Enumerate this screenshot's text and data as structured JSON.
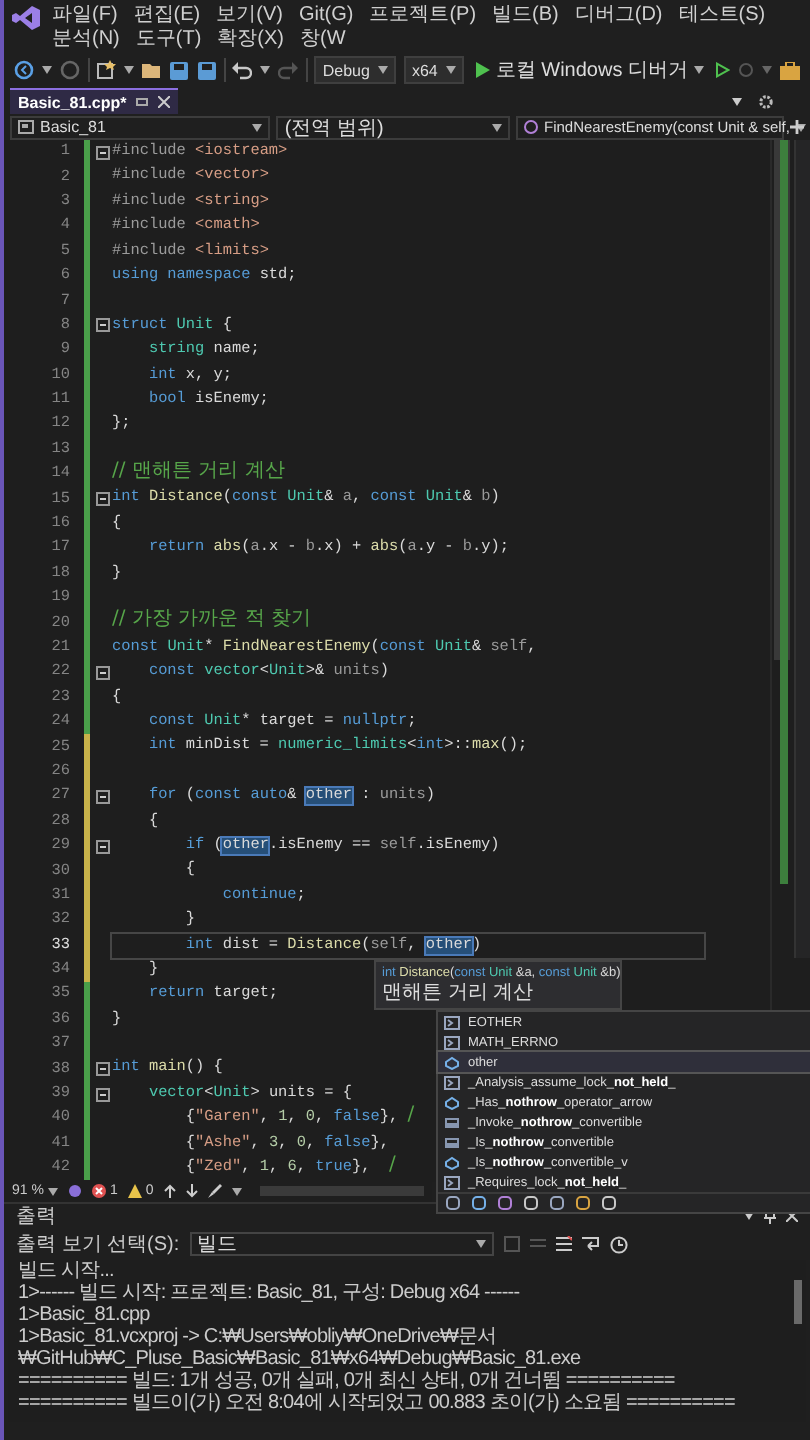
{
  "menu": [
    "파일(F)",
    "편집(E)",
    "보기(V)",
    "Git(G)",
    "프로젝트(P)",
    "빌드(B)",
    "디버그(D)",
    "테스트(S)",
    "분석(N)",
    "도구(T)",
    "확장(X)",
    "창(W"
  ],
  "toolbar": {
    "configuration": "Debug",
    "platform": "x64",
    "run_label": "로컬 Windows 디버거"
  },
  "tabs": [
    {
      "label": "Basic_81.cpp*",
      "selected": true
    }
  ],
  "navigation": {
    "project": "Basic_81",
    "scope": "(전역 범위)",
    "member": "FindNearestEnemy(const Unit & self,"
  },
  "editor": {
    "lines": [
      {
        "n": "1",
        "modified": false,
        "fold": true,
        "current": false,
        "tokens": [
          {
            "kind": "pp",
            "text": "#include "
          },
          {
            "kind": "str",
            "text": "<iostream>"
          }
        ]
      },
      {
        "n": "2",
        "modified": false,
        "fold": false,
        "current": false,
        "tokens": [
          {
            "kind": "pp",
            "text": "#include "
          },
          {
            "kind": "str",
            "text": "<vector>"
          }
        ]
      },
      {
        "n": "3",
        "modified": false,
        "fold": false,
        "current": false,
        "tokens": [
          {
            "kind": "pp",
            "text": "#include "
          },
          {
            "kind": "str",
            "text": "<string>"
          }
        ]
      },
      {
        "n": "4",
        "modified": false,
        "fold": false,
        "current": false,
        "tokens": [
          {
            "kind": "pp",
            "text": "#include "
          },
          {
            "kind": "str",
            "text": "<cmath>"
          }
        ]
      },
      {
        "n": "5",
        "modified": false,
        "fold": false,
        "current": false,
        "tokens": [
          {
            "kind": "pp",
            "text": "#include "
          },
          {
            "kind": "str",
            "text": "<limits>"
          }
        ]
      },
      {
        "n": "6",
        "modified": false,
        "fold": false,
        "current": false,
        "tokens": [
          {
            "kind": "kw",
            "text": "using namespace"
          },
          {
            "kind": "tx",
            "text": " std;"
          }
        ]
      },
      {
        "n": "7",
        "modified": false,
        "fold": false,
        "current": false
      },
      {
        "n": "8",
        "modified": false,
        "fold": true,
        "current": false,
        "tokens": [
          {
            "kind": "kw",
            "text": "struct "
          },
          {
            "kind": "type",
            "text": "Unit"
          },
          {
            "kind": "tx",
            "text": " {"
          }
        ]
      },
      {
        "n": "9",
        "modified": false,
        "fold": false,
        "current": false,
        "tokens": [
          {
            "kind": "type",
            "text": "    string"
          },
          {
            "kind": "tx",
            "text": " name;"
          }
        ]
      },
      {
        "n": "10",
        "modified": false,
        "fold": false,
        "current": false,
        "tokens": [
          {
            "kind": "kw",
            "text": "    int"
          },
          {
            "kind": "tx",
            "text": " x, y;"
          }
        ]
      },
      {
        "n": "11",
        "modified": false,
        "fold": false,
        "current": false,
        "tokens": [
          {
            "kind": "kw",
            "text": "    bool"
          },
          {
            "kind": "tx",
            "text": " isEnemy;"
          }
        ]
      },
      {
        "n": "12",
        "modified": false,
        "fold": false,
        "current": false,
        "tokens": [
          {
            "kind": "tx",
            "text": "};"
          }
        ]
      },
      {
        "n": "13",
        "modified": false,
        "fold": false,
        "current": false
      },
      {
        "n": "14",
        "modified": false,
        "fold": false,
        "current": false,
        "tokens": [
          {
            "kind": "cm",
            "text": "// 맨해튼 거리 계산"
          }
        ]
      },
      {
        "n": "15",
        "modified": false,
        "fold": true,
        "current": false,
        "tokens": [
          {
            "kind": "kw",
            "text": "int "
          },
          {
            "kind": "fn",
            "text": "Distance"
          },
          {
            "kind": "tx",
            "text": "("
          },
          {
            "kind": "kw",
            "text": "const "
          },
          {
            "kind": "type",
            "text": "Unit"
          },
          {
            "kind": "tx",
            "text": "& "
          },
          {
            "kind": "par",
            "text": "a"
          },
          {
            "kind": "tx",
            "text": ", "
          },
          {
            "kind": "kw",
            "text": "const "
          },
          {
            "kind": "type",
            "text": "Unit"
          },
          {
            "kind": "tx",
            "text": "& "
          },
          {
            "kind": "par",
            "text": "b"
          },
          {
            "kind": "tx",
            "text": ")"
          }
        ]
      },
      {
        "n": "16",
        "modified": false,
        "fold": false,
        "current": false,
        "tokens": [
          {
            "kind": "tx",
            "text": "{"
          }
        ]
      },
      {
        "n": "17",
        "modified": false,
        "fold": false,
        "current": false,
        "tokens": [
          {
            "kind": "kw",
            "text": "    return "
          },
          {
            "kind": "fn",
            "text": "abs"
          },
          {
            "kind": "tx",
            "text": "("
          },
          {
            "kind": "par",
            "text": "a"
          },
          {
            "kind": "tx",
            "text": ".x - "
          },
          {
            "kind": "par",
            "text": "b"
          },
          {
            "kind": "tx",
            "text": ".x) + "
          },
          {
            "kind": "fn",
            "text": "abs"
          },
          {
            "kind": "tx",
            "text": "("
          },
          {
            "kind": "par",
            "text": "a"
          },
          {
            "kind": "tx",
            "text": ".y - "
          },
          {
            "kind": "par",
            "text": "b"
          },
          {
            "kind": "tx",
            "text": ".y);"
          }
        ]
      },
      {
        "n": "18",
        "modified": false,
        "fold": false,
        "current": false,
        "tokens": [
          {
            "kind": "tx",
            "text": "}"
          }
        ]
      },
      {
        "n": "19",
        "modified": false,
        "fold": false,
        "current": false
      },
      {
        "n": "20",
        "modified": false,
        "fold": false,
        "current": false,
        "tokens": [
          {
            "kind": "cm",
            "text": "// 가장 가까운 적 찾기"
          }
        ]
      },
      {
        "n": "21",
        "modified": false,
        "fold": false,
        "current": false,
        "tokens": [
          {
            "kind": "kw",
            "text": "const "
          },
          {
            "kind": "type",
            "text": "Unit"
          },
          {
            "kind": "tx",
            "text": "* "
          },
          {
            "kind": "fn",
            "text": "FindNearestEnemy"
          },
          {
            "kind": "tx",
            "text": "("
          },
          {
            "kind": "kw",
            "text": "const "
          },
          {
            "kind": "type",
            "text": "Unit"
          },
          {
            "kind": "tx",
            "text": "& "
          },
          {
            "kind": "par",
            "text": "self"
          },
          {
            "kind": "tx",
            "text": ","
          }
        ]
      },
      {
        "n": "22",
        "modified": false,
        "fold": true,
        "current": false,
        "tokens": [
          {
            "kind": "kw",
            "text": "    const "
          },
          {
            "kind": "type",
            "text": "vector"
          },
          {
            "kind": "tx",
            "text": "<"
          },
          {
            "kind": "type",
            "text": "Unit"
          },
          {
            "kind": "tx",
            "text": ">& "
          },
          {
            "kind": "par",
            "text": "units"
          },
          {
            "kind": "tx",
            "text": ")"
          }
        ]
      },
      {
        "n": "23",
        "modified": false,
        "fold": false,
        "current": false,
        "tokens": [
          {
            "kind": "tx",
            "text": "{"
          }
        ]
      },
      {
        "n": "24",
        "modified": false,
        "fold": false,
        "current": false,
        "tokens": [
          {
            "kind": "kw",
            "text": "    const "
          },
          {
            "kind": "type",
            "text": "Unit"
          },
          {
            "kind": "tx",
            "text": "* target = "
          },
          {
            "kind": "kw",
            "text": "nullptr"
          },
          {
            "kind": "tx",
            "text": ";"
          }
        ]
      },
      {
        "n": "25",
        "modified": true,
        "fold": false,
        "current": false,
        "tokens": [
          {
            "kind": "kw",
            "text": "    int "
          },
          {
            "kind": "tx",
            "text": "minDist = "
          },
          {
            "kind": "type",
            "text": "numeric_limits"
          },
          {
            "kind": "tx",
            "text": "<"
          },
          {
            "kind": "kw",
            "text": "int"
          },
          {
            "kind": "tx",
            "text": ">::"
          },
          {
            "kind": "fn",
            "text": "max"
          },
          {
            "kind": "tx",
            "text": "();"
          }
        ]
      },
      {
        "n": "26",
        "modified": true,
        "fold": false,
        "current": false
      },
      {
        "n": "27",
        "modified": true,
        "fold": true,
        "current": false,
        "tokens": [
          {
            "kind": "kw",
            "text": "    for "
          },
          {
            "kind": "tx",
            "text": "("
          },
          {
            "kind": "kw",
            "text": "const auto"
          },
          {
            "kind": "tx",
            "text": "& "
          },
          {
            "kind": "sel",
            "text": "other"
          },
          {
            "kind": "tx",
            "text": " : "
          },
          {
            "kind": "par",
            "text": "units"
          },
          {
            "kind": "tx",
            "text": ")"
          }
        ]
      },
      {
        "n": "28",
        "modified": true,
        "fold": false,
        "current": false,
        "tokens": [
          {
            "kind": "tx",
            "text": "    {"
          }
        ]
      },
      {
        "n": "29",
        "modified": true,
        "fold": true,
        "current": false,
        "tokens": [
          {
            "kind": "kw",
            "text": "        if "
          },
          {
            "kind": "tx",
            "text": "("
          },
          {
            "kind": "sel",
            "text": "other"
          },
          {
            "kind": "tx",
            "text": ".isEnemy == "
          },
          {
            "kind": "par",
            "text": "self"
          },
          {
            "kind": "tx",
            "text": ".isEnemy)"
          }
        ]
      },
      {
        "n": "30",
        "modified": true,
        "fold": false,
        "current": false,
        "tokens": [
          {
            "kind": "tx",
            "text": "        {"
          }
        ]
      },
      {
        "n": "31",
        "modified": true,
        "fold": false,
        "current": false,
        "tokens": [
          {
            "kind": "kw",
            "text": "            continue"
          },
          {
            "kind": "tx",
            "text": ";"
          }
        ]
      },
      {
        "n": "32",
        "modified": true,
        "fold": false,
        "current": false,
        "tokens": [
          {
            "kind": "tx",
            "text": "        }"
          }
        ]
      },
      {
        "n": "33",
        "modified": true,
        "fold": false,
        "current": true,
        "tokens": [
          {
            "kind": "kw",
            "text": "        int "
          },
          {
            "kind": "tx",
            "text": "dist = "
          },
          {
            "kind": "fn",
            "text": "Distance"
          },
          {
            "kind": "tx",
            "text": "("
          },
          {
            "kind": "par",
            "text": "self"
          },
          {
            "kind": "tx",
            "text": ", "
          },
          {
            "kind": "sel",
            "text": "other"
          },
          {
            "kind": "tx",
            "text": ")"
          }
        ]
      },
      {
        "n": "34",
        "modified": true,
        "fold": false,
        "current": false,
        "tokens": [
          {
            "kind": "tx",
            "text": "    }"
          }
        ]
      },
      {
        "n": "35",
        "modified": false,
        "fold": false,
        "current": false,
        "tokens": [
          {
            "kind": "kw",
            "text": "    return "
          },
          {
            "kind": "tx",
            "text": "target;"
          }
        ]
      },
      {
        "n": "36",
        "modified": false,
        "fold": false,
        "current": false,
        "tokens": [
          {
            "kind": "tx",
            "text": "}"
          }
        ]
      },
      {
        "n": "37",
        "modified": false,
        "fold": false,
        "current": false
      },
      {
        "n": "38",
        "modified": false,
        "fold": true,
        "current": false,
        "tokens": [
          {
            "kind": "kw",
            "text": "int "
          },
          {
            "kind": "fn",
            "text": "main"
          },
          {
            "kind": "tx",
            "text": "() {"
          }
        ]
      },
      {
        "n": "39",
        "modified": false,
        "fold": true,
        "current": false,
        "tokens": [
          {
            "kind": "type",
            "text": "    vector"
          },
          {
            "kind": "tx",
            "text": "<"
          },
          {
            "kind": "type",
            "text": "Unit"
          },
          {
            "kind": "tx",
            "text": "> units = {"
          }
        ]
      },
      {
        "n": "40",
        "modified": false,
        "fold": false,
        "current": false,
        "tokens": [
          {
            "kind": "tx",
            "text": "        {"
          },
          {
            "kind": "str",
            "text": "\"Garen\""
          },
          {
            "kind": "tx",
            "text": ", "
          },
          {
            "kind": "num",
            "text": "1"
          },
          {
            "kind": "tx",
            "text": ", "
          },
          {
            "kind": "num",
            "text": "0"
          },
          {
            "kind": "tx",
            "text": ", "
          },
          {
            "kind": "kw",
            "text": "false"
          },
          {
            "kind": "tx",
            "text": "}, "
          },
          {
            "kind": "cm",
            "text": "/"
          }
        ]
      },
      {
        "n": "41",
        "modified": false,
        "fold": false,
        "current": false,
        "tokens": [
          {
            "kind": "tx",
            "text": "        {"
          },
          {
            "kind": "str",
            "text": "\"Ashe\""
          },
          {
            "kind": "tx",
            "text": ", "
          },
          {
            "kind": "num",
            "text": "3"
          },
          {
            "kind": "tx",
            "text": ", "
          },
          {
            "kind": "num",
            "text": "0"
          },
          {
            "kind": "tx",
            "text": ", "
          },
          {
            "kind": "kw",
            "text": "false"
          },
          {
            "kind": "tx",
            "text": "},"
          }
        ]
      },
      {
        "n": "42",
        "modified": false,
        "fold": false,
        "current": false,
        "tokens": [
          {
            "kind": "tx",
            "text": "        {"
          },
          {
            "kind": "str",
            "text": "\"Zed\""
          },
          {
            "kind": "tx",
            "text": ", "
          },
          {
            "kind": "num",
            "text": "1"
          },
          {
            "kind": "tx",
            "text": ", "
          },
          {
            "kind": "num",
            "text": "6"
          },
          {
            "kind": "tx",
            "text": ", "
          },
          {
            "kind": "kw",
            "text": "true"
          },
          {
            "kind": "tx",
            "text": "},  "
          },
          {
            "kind": "cm",
            "text": "/"
          }
        ]
      }
    ]
  },
  "signature_tooltip": {
    "signature": [
      {
        "kind": "kw",
        "text": "int "
      },
      {
        "kind": "fn",
        "text": "Distance"
      },
      {
        "kind": "tx",
        "text": "("
      },
      {
        "kind": "kw",
        "text": "const "
      },
      {
        "kind": "type",
        "text": "Unit"
      },
      {
        "kind": "tx",
        "text": " &a, "
      },
      {
        "kind": "kw",
        "text": "const "
      },
      {
        "kind": "type",
        "text": "Unit"
      },
      {
        "kind": "tx",
        "text": " &b)"
      }
    ],
    "description": "맨해튼 거리 계산"
  },
  "completion": [
    {
      "kind": "macro",
      "label": "EOTHER",
      "selected": false
    },
    {
      "kind": "macro",
      "label": "MATH_ERRNO",
      "selected": false
    },
    {
      "kind": "variable",
      "label": "other",
      "selected": true
    },
    {
      "kind": "macro",
      "label": "_Analysis_assume_lock_**not_held**_",
      "selected": false
    },
    {
      "kind": "variable",
      "label": "_Has_**nothrow**_operator_arrow",
      "selected": false
    },
    {
      "kind": "template",
      "label": "_Invoke_**nothrow**_convertible",
      "selected": false
    },
    {
      "kind": "template",
      "label": "_Is_**nothrow**_convertible",
      "selected": false
    },
    {
      "kind": "variable",
      "label": "_Is_**nothrow**_convertible_v",
      "selected": false
    },
    {
      "kind": "macro",
      "label": "_Requires_lock_**not_held**_",
      "selected": false
    }
  ],
  "status_bar": {
    "zoom": "91 %",
    "errors": "1",
    "warnings": "0"
  },
  "output": {
    "title": "출력",
    "source_label": "출력 보기 선택(S):",
    "source": "빌드",
    "lines": [
      "빌드 시작...",
      "1>------ 빌드 시작: 프로젝트: Basic_81, 구성: Debug x64 ------",
      "1>Basic_81.cpp",
      "1>Basic_81.vcxproj -> C:₩Users₩obliy₩OneDrive₩문서₩GitHub₩C_Pluse_Basic₩Basic_81₩x64₩Debug₩Basic_81.exe",
      "========== 빌드: 1개 성공, 0개 실패, 0개 최신 상태, 0개 건너뜀 ==========",
      "========== 빌드이(가) 오전 8:04에 시작되었고 00.883 초이(가) 소요됨 =========="
    ]
  }
}
